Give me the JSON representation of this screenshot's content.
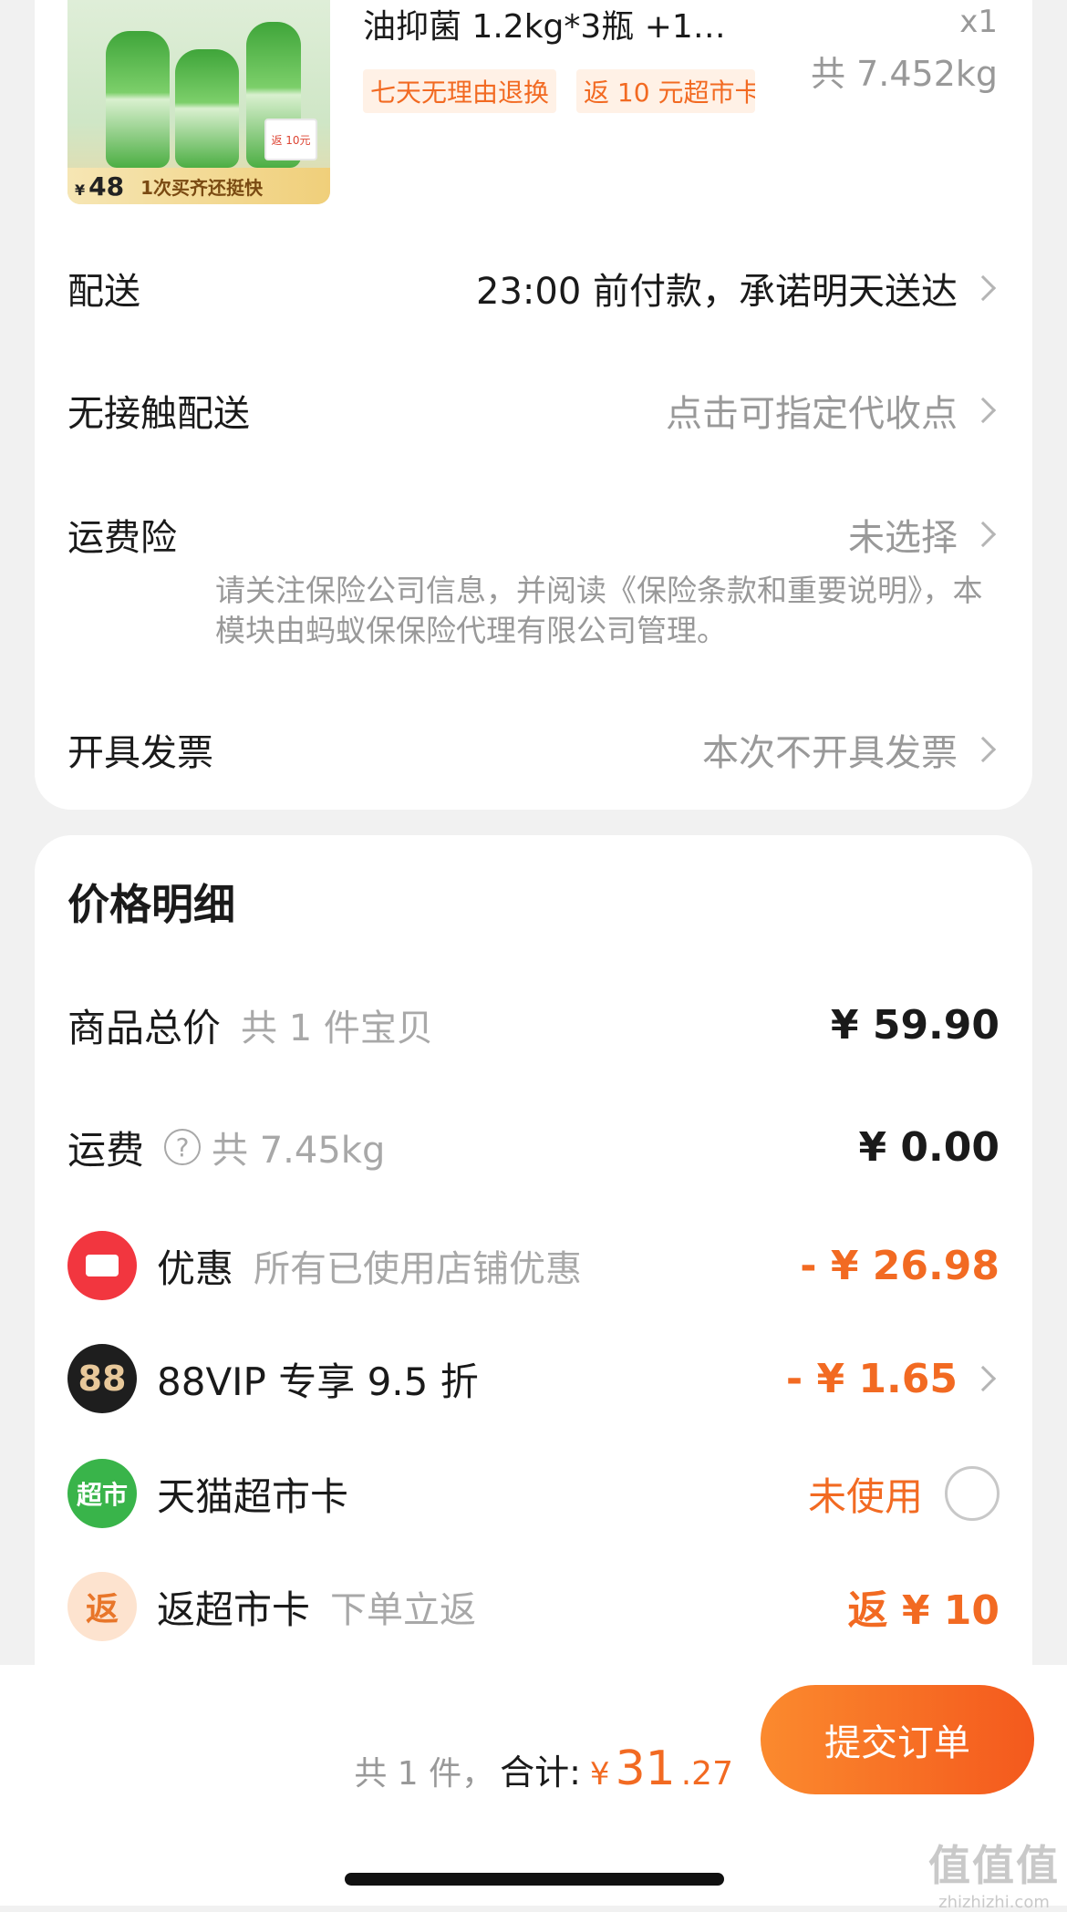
{
  "product": {
    "title": "油抑菌 1.2kg*3瓶 +1…",
    "qty": "x1",
    "weight": "共 7.452kg",
    "tags": [
      "七天无理由退换",
      "返 10 元超市卡"
    ],
    "image": {
      "price_symbol": "¥",
      "price": "48",
      "slogan": "1次买齐还挺快",
      "badge": "返 10元"
    }
  },
  "options": [
    {
      "label": "配送",
      "value": "23:00 前付款，承诺明天送达"
    },
    {
      "label": "无接触配送",
      "value": "点击可指定代收点"
    },
    {
      "label": "运费险",
      "value": "未选择"
    },
    {
      "label": "开具发票",
      "value": "本次不开具发票"
    }
  ],
  "insurance_note": "请关注保险公司信息，并阅读《保险条款和重要说明》，本模块由蚂蚁保保险代理有限公司管理。",
  "price_detail": {
    "title": "价格明细",
    "goods": {
      "label": "商品总价",
      "sub": "共 1 件宝贝",
      "amount": "¥ 59.90"
    },
    "shipping": {
      "label": "运费",
      "help": "?",
      "sub": "共 7.45kg",
      "amount": "¥ 0.00"
    },
    "discount": {
      "label": "优惠",
      "sub": "所有已使用店铺优惠",
      "amount": "- ¥ 26.98"
    },
    "vip": {
      "icon_text": "88",
      "label": "88VIP 专享 9.5 折",
      "amount": "- ¥ 1.65"
    },
    "tmall_card": {
      "icon_text": "超市",
      "label": "天猫超市卡",
      "status": "未使用"
    },
    "rebate": {
      "icon_text": "返",
      "label": "返超市卡",
      "sub": "下单立返",
      "amount": "返 ¥ 10"
    }
  },
  "footer": {
    "count": "共 1 件，",
    "total_label": "合计:",
    "yen": "¥",
    "total_int": "31",
    "total_dec": ".27",
    "submit": "提交订单"
  },
  "watermark": {
    "logo": "值值值",
    "url": "zhizhizhi.com"
  },
  "colors": {
    "accent": "#f26a22",
    "muted": "#999999",
    "background": "#f1f1f1"
  }
}
